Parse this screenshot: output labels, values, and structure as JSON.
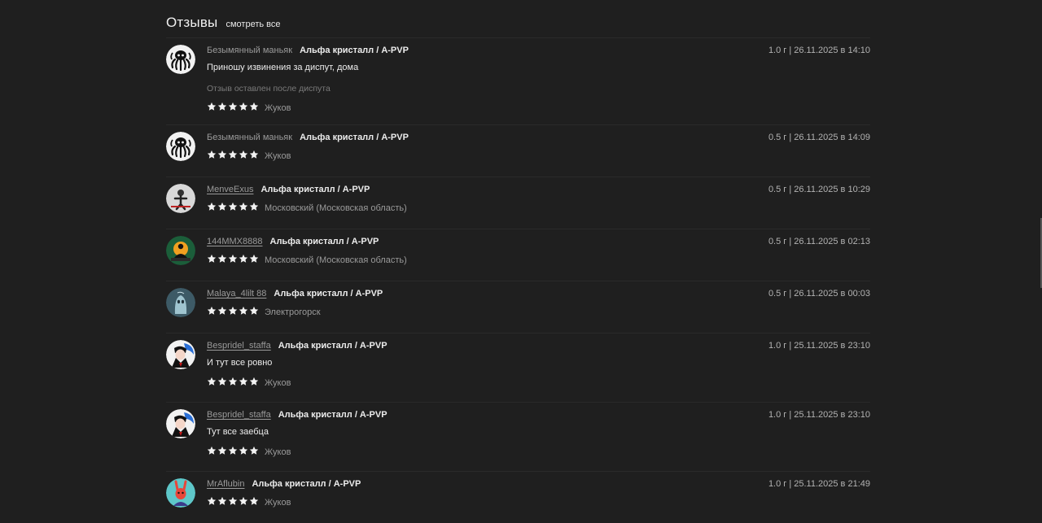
{
  "header": {
    "title": "Отзывы",
    "see_all": "смотреть все"
  },
  "reviews": [
    {
      "author": "Безымянный маньяк",
      "author_link": false,
      "product": "Альфа кристалл / A-PVP",
      "date": "1.0 г | 26.11.2025 в 14:10",
      "text": "Приношу извинения за диспут, дома",
      "note": "Отзыв оставлен после диспута",
      "rating": 5,
      "city": "Жуков",
      "avatar_icon": "octopus-avatar-icon"
    },
    {
      "author": "Безымянный маньяк",
      "author_link": false,
      "product": "Альфа кристалл / A-PVP",
      "date": "0.5 г | 26.11.2025 в 14:09",
      "rating": 5,
      "city": "Жуков",
      "avatar_icon": "octopus-avatar-icon"
    },
    {
      "author": "MenveExus",
      "author_link": true,
      "product": "Альфа кристалл / A-PVP",
      "date": "0.5 г | 26.11.2025 в 10:29",
      "rating": 5,
      "city": "Московский (Московская область)",
      "avatar_icon": "figure-avatar-icon"
    },
    {
      "author": "144MMX8888",
      "author_link": true,
      "product": "Альфа кристалл / A-PVP",
      "date": "0.5 г | 26.11.2025 в 02:13",
      "rating": 5,
      "city": "Московский (Московская область)",
      "avatar_icon": "meditation-avatar-icon"
    },
    {
      "author": "Malaya_4lilt 88",
      "author_link": true,
      "product": "Альфа кристалл / A-PVP",
      "date": "0.5 г | 26.11.2025 в 00:03",
      "rating": 5,
      "city": "Электрогорск",
      "avatar_icon": "ghost-avatar-icon"
    },
    {
      "author": "Bespridel_staffa",
      "author_link": true,
      "product": "Альфа кристалл / A-PVP",
      "date": "1.0 г | 25.11.2025 в 23:10",
      "text": "И тут все ровно",
      "rating": 5,
      "city": "Жуков",
      "avatar_icon": "vampire-avatar-icon"
    },
    {
      "author": "Bespridel_staffa",
      "author_link": true,
      "product": "Альфа кристалл / A-PVP",
      "date": "1.0 г | 25.11.2025 в 23:10",
      "text": "Тут все заебца",
      "rating": 5,
      "city": "Жуков",
      "avatar_icon": "vampire-avatar-icon"
    },
    {
      "author": "MrAflubin",
      "author_link": true,
      "product": "Альфа кристалл / A-PVP",
      "date": "1.0 г | 25.11.2025 в 21:49",
      "rating": 5,
      "city": "Жуков",
      "avatar_icon": "rabbit-avatar-icon"
    }
  ],
  "colors": {
    "background": "#1f1f1f",
    "divider": "#2a2a2a",
    "star": "#f2f2f2",
    "muted_text": "#9a9a9a"
  }
}
